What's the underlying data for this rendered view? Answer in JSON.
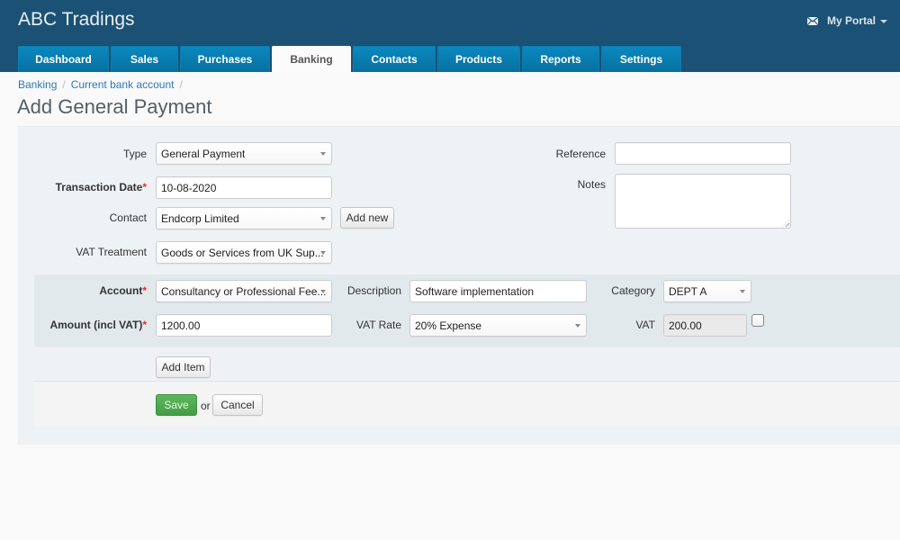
{
  "app": {
    "title": "ABC Tradings",
    "portal_label": "My Portal",
    "mail_icon": "envelope-icon"
  },
  "nav": {
    "tabs": [
      {
        "label": "Dashboard",
        "active": false
      },
      {
        "label": "Sales",
        "active": false
      },
      {
        "label": "Purchases",
        "active": false
      },
      {
        "label": "Banking",
        "active": true
      },
      {
        "label": "Contacts",
        "active": false
      },
      {
        "label": "Products",
        "active": false
      },
      {
        "label": "Reports",
        "active": false
      },
      {
        "label": "Settings",
        "active": false
      }
    ]
  },
  "breadcrumb": {
    "items": [
      "Banking",
      "Current bank account"
    ],
    "separator": "/"
  },
  "page": {
    "title": "Add General Payment"
  },
  "form": {
    "type": {
      "label": "Type",
      "value": "General Payment"
    },
    "transaction_date": {
      "label": "Transaction Date",
      "required_mark": "*",
      "value": "10-08-2020"
    },
    "contact": {
      "label": "Contact",
      "value": "Endcorp Limited",
      "add_new_label": "Add new"
    },
    "vat_treatment": {
      "label": "VAT Treatment",
      "value": "Goods or Services from UK Sup..."
    },
    "reference": {
      "label": "Reference",
      "value": ""
    },
    "notes": {
      "label": "Notes",
      "value": ""
    }
  },
  "item": {
    "account": {
      "label": "Account",
      "required_mark": "*",
      "value": "Consultancy or Professional Fee..."
    },
    "amount": {
      "label": "Amount (incl VAT)",
      "required_mark": "*",
      "value": "1200.00"
    },
    "description": {
      "label": "Description",
      "value": "Software implementation"
    },
    "vat_rate": {
      "label": "VAT Rate",
      "value": "20% Expense"
    },
    "category": {
      "label": "Category",
      "value": "DEPT A"
    },
    "vat": {
      "label": "VAT",
      "value": "200.00",
      "manual_override_checked": false
    }
  },
  "actions": {
    "add_item_label": "Add Item",
    "save_label": "Save",
    "or_text": "or",
    "cancel_label": "Cancel"
  },
  "colors": {
    "header_bg": "#1b5174",
    "tab_bg": "#0a88bf",
    "save_green": "#4cae4c",
    "link_blue": "#2a7ab8",
    "required_red": "#dd3333"
  }
}
